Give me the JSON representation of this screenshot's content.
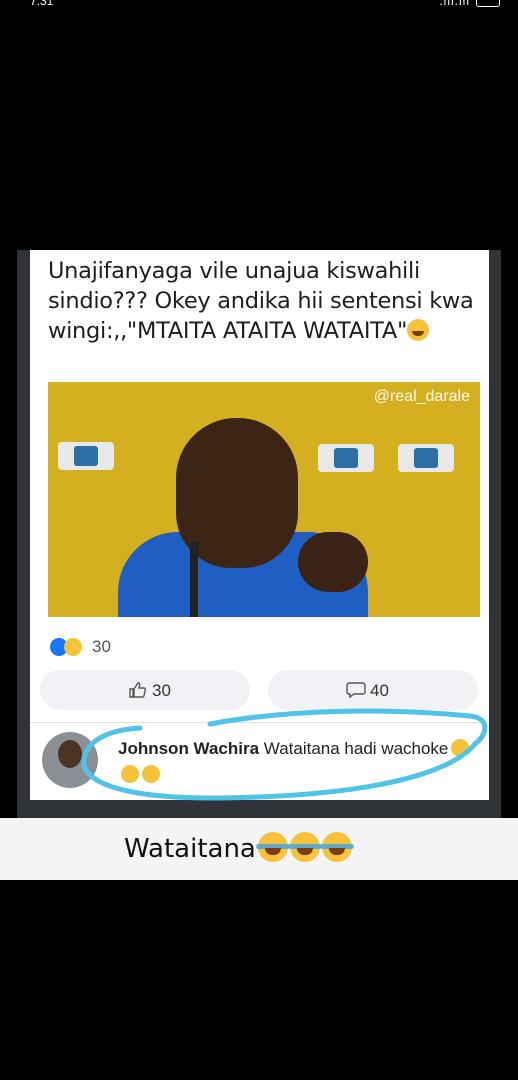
{
  "status_bar": {
    "time": "7:31",
    "signal": ".ill.ill"
  },
  "post": {
    "caption": "Unajifanyaga vile unajua kiswahili sindio??? Okey andika hii sentensi kwa wingi:,,\"MTAITA ATAITA WATAITA\"",
    "watermark": "@real_darale",
    "reactions_count": "30",
    "like_count": "30",
    "comment_count": "40",
    "comment": {
      "author": "Johnson Wachira",
      "text": "Wataitana hadi wachoke"
    }
  },
  "bottom_caption": {
    "text": "Wataitana"
  },
  "icons": {
    "like": "thumbs-up-icon",
    "comment": "comment-bubble-icon",
    "reaction_like": "like-reaction-icon",
    "reaction_haha": "haha-reaction-icon"
  },
  "colors": {
    "scribble": "#4fc3e8",
    "reaction_like": "#1877f2",
    "emoji": "#f5c23a"
  }
}
